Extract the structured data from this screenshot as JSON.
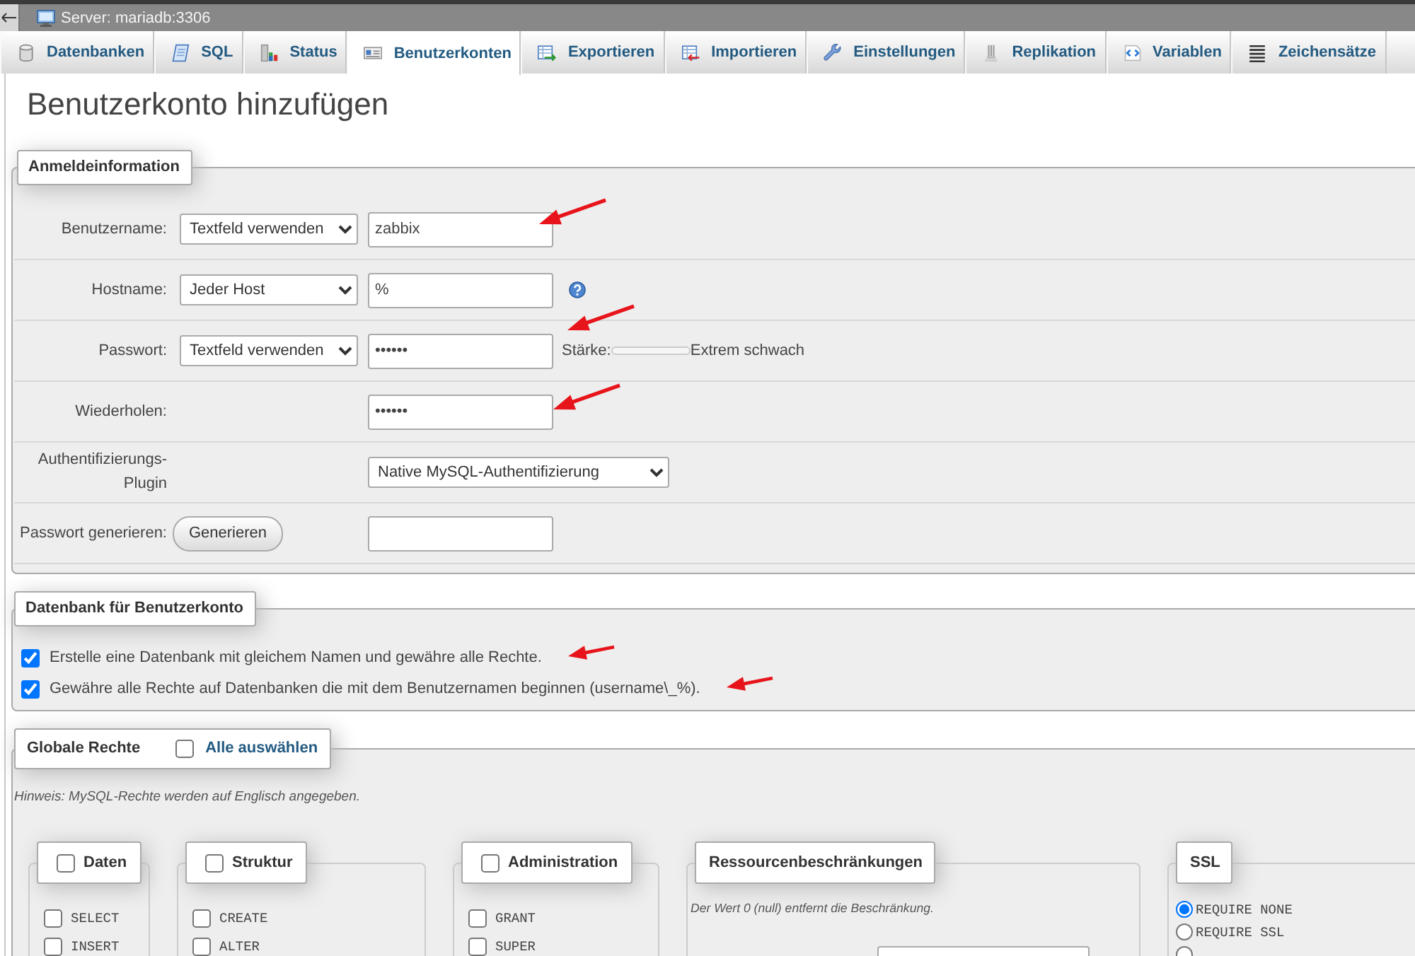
{
  "top_bar": {
    "server_link": "Server: mariadb:3306"
  },
  "tabs": [
    {
      "label": "Datenbanken",
      "selected": false
    },
    {
      "label": "SQL",
      "selected": false
    },
    {
      "label": "Status",
      "selected": false
    },
    {
      "label": "Benutzerkonten",
      "selected": true
    },
    {
      "label": "Exportieren",
      "selected": false
    },
    {
      "label": "Importieren",
      "selected": false
    },
    {
      "label": "Einstellungen",
      "selected": false
    },
    {
      "label": "Replikation",
      "selected": false
    },
    {
      "label": "Variablen",
      "selected": false
    },
    {
      "label": "Zeichensätze",
      "selected": false
    }
  ],
  "title": "Benutzerkonto hinzufügen",
  "login": {
    "legend": "Anmeldeinformation",
    "rows": [
      {
        "kind": "select_input",
        "label": "Benutzername:",
        "select": "Textfeld verwenden",
        "value": "zabbix",
        "help": false,
        "annotated": true
      },
      {
        "kind": "select_input",
        "label": "Hostname:",
        "select": "Jeder Host",
        "value": "%",
        "help": true,
        "annotated": false
      },
      {
        "kind": "select_input",
        "label": "Passwort:",
        "select": "Textfeld verwenden",
        "value": "••••••",
        "help": false,
        "annotated": true,
        "strength": {
          "label": "Stärke:",
          "level": 0,
          "text": "Extrem schwach"
        }
      },
      {
        "kind": "input",
        "label": "Wiederholen:",
        "value": "••••••",
        "help": false,
        "annotated": true
      },
      {
        "kind": "wide_select",
        "label": "Authentifizierungs-Plugin",
        "select": "Native MySQL-Authentifizierung",
        "help": false,
        "annotated": false
      },
      {
        "kind": "button_input",
        "label": "Passwort generieren:",
        "button": "Generieren",
        "help": false,
        "annotated": false
      }
    ]
  },
  "database": {
    "legend": "Datenbank für Benutzerkonto",
    "options": [
      {
        "label": "Erstelle eine Datenbank mit gleichem Namen und gewähre alle Rechte.",
        "checked": true,
        "annotated": true
      },
      {
        "label": "Gewähre alle Rechte auf Datenbanken die mit dem Benutzernamen beginnen (username\\_%).",
        "checked": true,
        "annotated": true
      }
    ]
  },
  "privileges": {
    "legend": "Globale Rechte",
    "select_all": {
      "label": "Alle auswählen",
      "checked": false
    },
    "note": "Hinweis: MySQL-Rechte werden auf Englisch angegeben.",
    "groups": [
      {
        "kind": "checklist",
        "legend": "Daten",
        "checked": false,
        "items": [
          {
            "label": "SELECT",
            "checked": false
          },
          {
            "label": "INSERT",
            "checked": false
          }
        ]
      },
      {
        "kind": "checklist",
        "legend": "Struktur",
        "checked": false,
        "items": [
          {
            "label": "CREATE",
            "checked": false
          },
          {
            "label": "ALTER",
            "checked": false
          }
        ]
      },
      {
        "kind": "checklist",
        "legend": "Administration",
        "checked": false,
        "items": [
          {
            "label": "GRANT",
            "checked": false
          },
          {
            "label": "SUPER",
            "checked": false
          }
        ]
      },
      {
        "kind": "limits",
        "legend": "Ressourcenbeschränkungen",
        "note": "Der Wert 0 (null) entfernt die Beschränkung.",
        "fields": [
          {
            "kind": "input"
          }
        ]
      },
      {
        "kind": "radios",
        "legend": "SSL",
        "options": [
          {
            "label": "REQUIRE NONE",
            "selected": true
          },
          {
            "label": "REQUIRE SSL",
            "selected": false
          },
          {
            "selected": false
          }
        ]
      }
    ]
  }
}
